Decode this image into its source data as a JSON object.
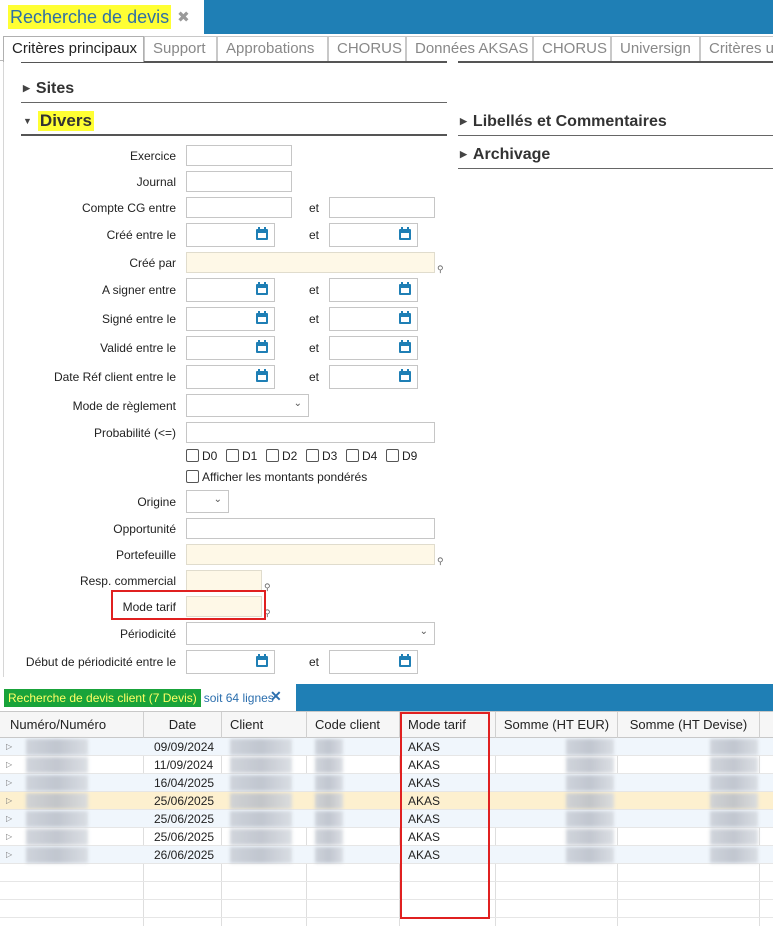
{
  "window": {
    "title": "Recherche de devis"
  },
  "tabs": [
    "Critères principaux",
    "Support",
    "Approbations",
    "CHORUS",
    "Données AKSAS",
    "CHORUS",
    "Universign",
    "Critères utilisateurs"
  ],
  "sections": {
    "sites": "Sites",
    "divers": "Divers",
    "libelles": "Libellés et Commentaires",
    "archivage": "Archivage"
  },
  "form": {
    "exercice": "Exercice",
    "journal": "Journal",
    "compte_cg": "Compte CG entre",
    "cree_entre": "Créé entre le",
    "cree_par": "Créé par",
    "a_signer": "A signer entre",
    "signe_entre": "Signé entre le",
    "valide_entre": "Validé entre le",
    "date_ref": "Date Réf client entre le",
    "mode_reglement": "Mode de règlement",
    "probabilite": "Probabilité (<=)",
    "afficher_montants": "Afficher les montants pondérés",
    "origine": "Origine",
    "opportunite": "Opportunité",
    "portefeuille": "Portefeuille",
    "resp_commercial": "Resp. commercial",
    "mode_tarif": "Mode tarif",
    "periodicite": "Périodicité",
    "debut_periodicite": "Début de périodicité entre le",
    "et": "et",
    "probas": [
      "D0",
      "D1",
      "D2",
      "D3",
      "D4",
      "D9"
    ]
  },
  "results": {
    "tab_label": "Recherche de devis client (7 Devis)",
    "count_text": "soit 64 lignes",
    "columns": [
      "Numéro/Numéro",
      "Date",
      "Client",
      "Code client",
      "Mode tarif",
      "Somme (HT EUR)",
      "Somme (HT Devise)"
    ],
    "rows": [
      {
        "date": "09/09/2024",
        "mode_tarif": "AKAS"
      },
      {
        "date": "11/09/2024",
        "mode_tarif": "AKAS"
      },
      {
        "date": "16/04/2025",
        "mode_tarif": "AKAS"
      },
      {
        "date": "25/06/2025",
        "mode_tarif": "AKAS"
      },
      {
        "date": "25/06/2025",
        "mode_tarif": "AKAS"
      },
      {
        "date": "25/06/2025",
        "mode_tarif": "AKAS"
      },
      {
        "date": "26/06/2025",
        "mode_tarif": "AKAS"
      }
    ]
  },
  "colors": {
    "accent": "#1f7fb5",
    "highlight": "#ffff33",
    "tab_highlight": "#19a33a",
    "annotation": "#e02020"
  },
  "icons": {
    "calendar": "calendar-icon",
    "close": "close-icon",
    "pin": "pin-icon",
    "dropdown": "chevron-down-icon"
  }
}
